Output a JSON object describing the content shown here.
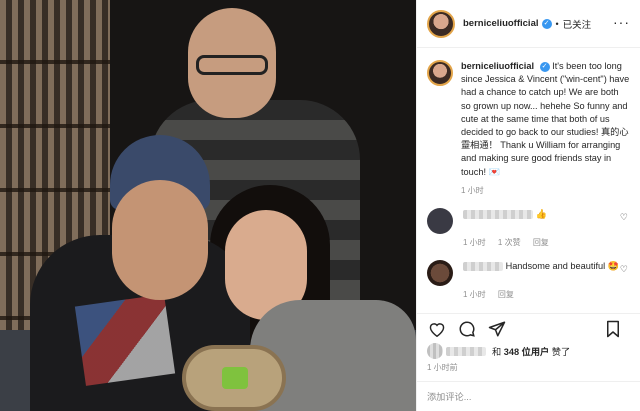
{
  "post": {
    "username": "berniceliuofficial",
    "follow_status": "已关注",
    "caption": "It's been too long since Jessica & Vincent (\"win-cent\") have had a chance to catch up! We are both so grown up now... hehehe So funny and cute at the same time that both of us decided to go back to our studies! 真的心靈相通！ Thank u William for arranging and making sure good friends stay in touch! 💌",
    "caption_time": "1 小时"
  },
  "comments": [
    {
      "text_suffix": "👍",
      "time": "1 小时",
      "likes": "1 次赞",
      "reply": "回复"
    },
    {
      "text": "Handsome and beautiful 🤩",
      "time": "1 小时",
      "reply": "回复"
    }
  ],
  "engagement": {
    "likes_prefix": "和",
    "likes_count_text": "348 位用户",
    "likes_suffix": "赞了",
    "posted_time": "1 小时前"
  },
  "composer": {
    "placeholder": "添加评论..."
  },
  "icons": {
    "more": "more-dots-icon",
    "verified": "verified-badge-icon",
    "heart": "heart-icon",
    "comment": "comment-icon",
    "share": "share-icon",
    "bookmark": "bookmark-icon"
  }
}
